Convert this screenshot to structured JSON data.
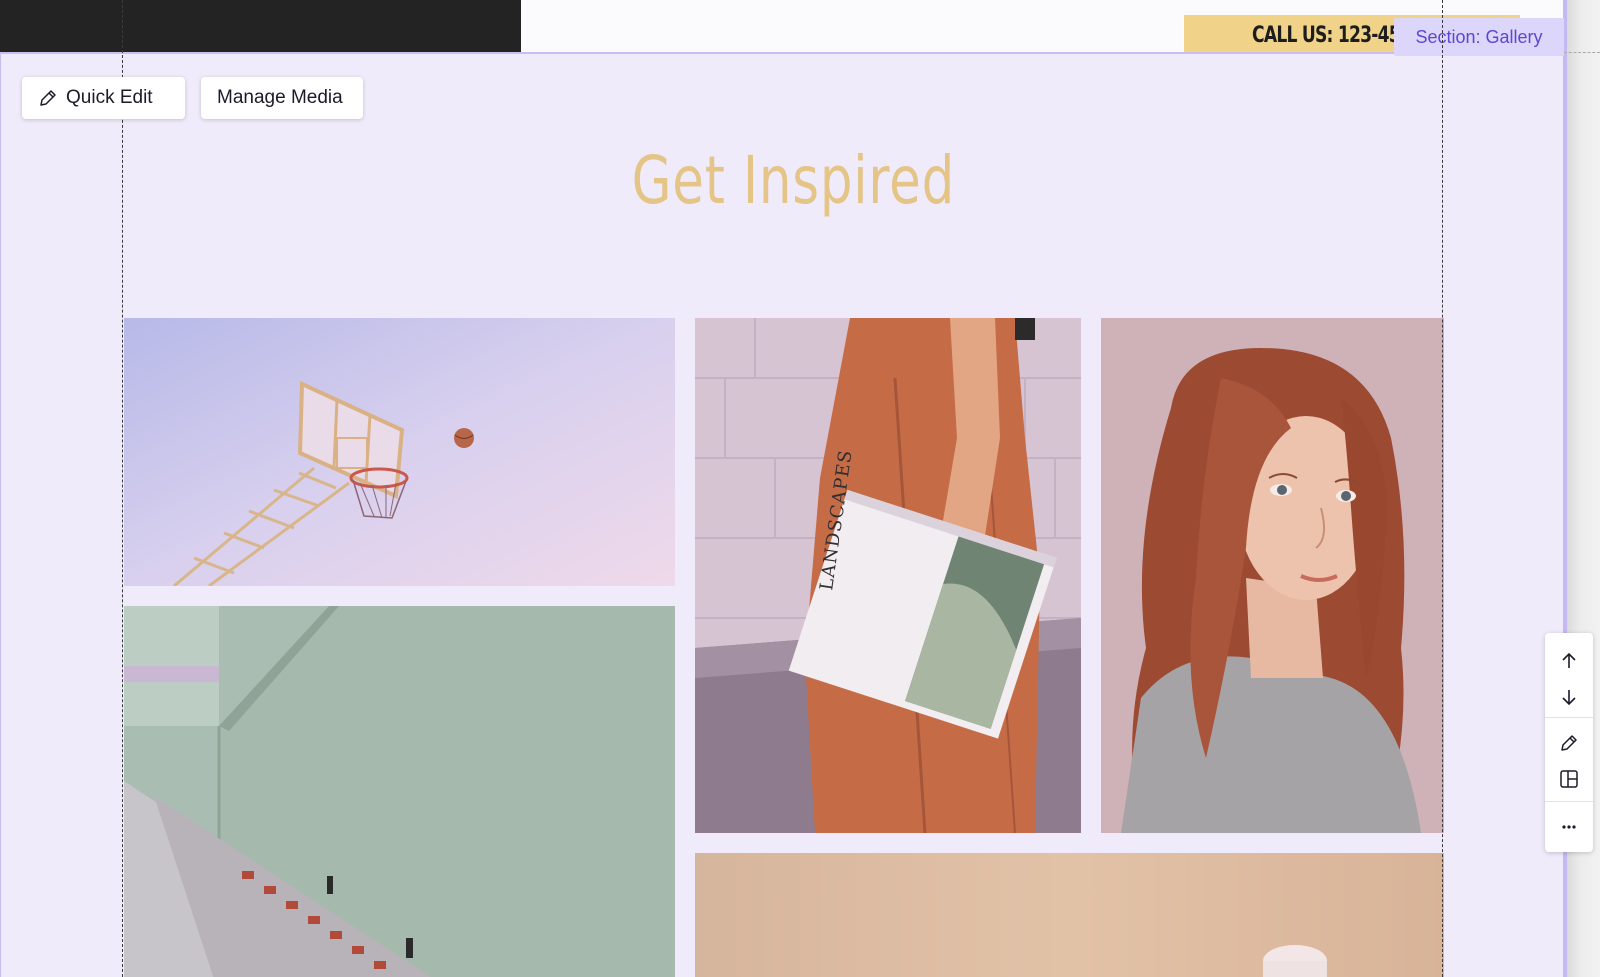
{
  "header": {
    "call_label": "CALL US: 123-45("
  },
  "section": {
    "tag_label": "Section: Gallery",
    "title": "Get Inspired"
  },
  "actions": {
    "quick_edit_label": "Quick Edit",
    "manage_media_label": "Manage Media"
  },
  "gallery": {
    "book_text": "LANDSCAPES",
    "images": [
      {
        "name": "basketball-hoop-image"
      },
      {
        "name": "woman-holding-book-image"
      },
      {
        "name": "red-haired-woman-portrait-image"
      },
      {
        "name": "stairs-wall-image"
      },
      {
        "name": "peach-product-image"
      }
    ]
  },
  "toolbar": {
    "items": [
      "arrow-up-icon",
      "arrow-down-icon",
      "pencil-icon",
      "layout-icon",
      "more-icon"
    ]
  },
  "colors": {
    "section_bg": "#efebfb",
    "title": "#e4c587",
    "tag_bg": "#ddd6fb",
    "tag_text": "#5a48d0",
    "call_bg": "#f0d389"
  }
}
